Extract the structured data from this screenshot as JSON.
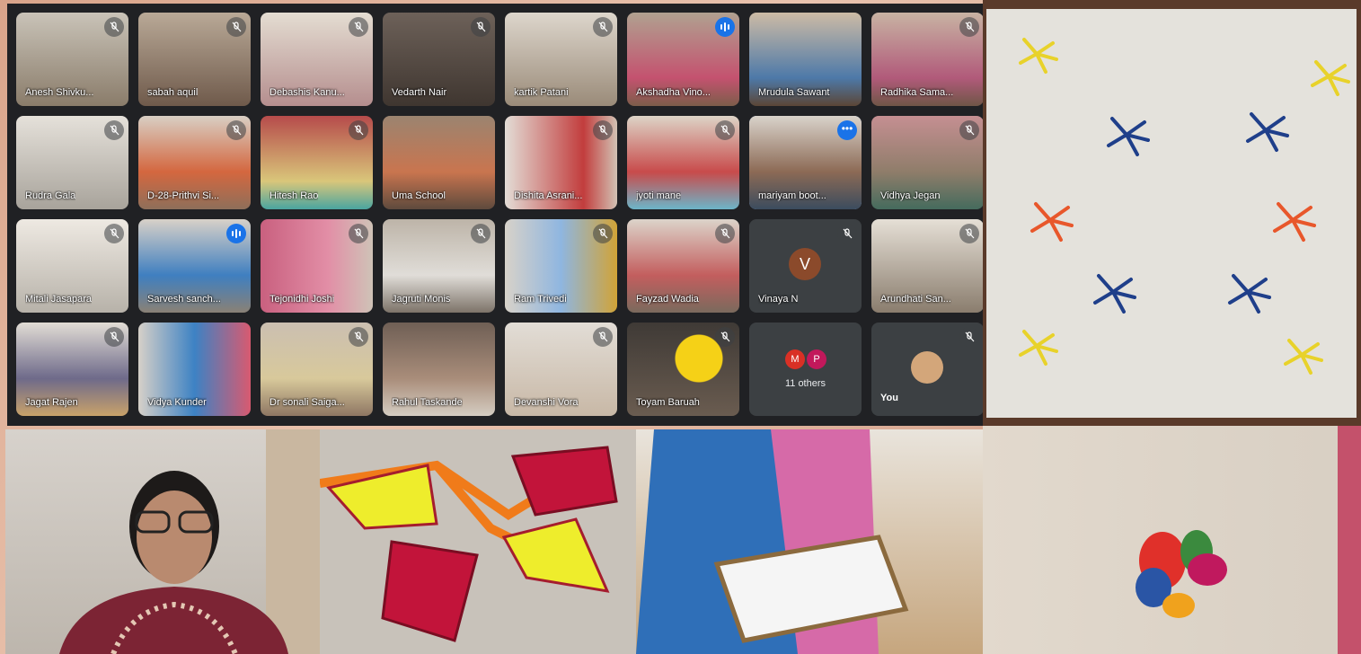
{
  "meet": {
    "tiles": [
      {
        "name": "Anesh Shivku..."
      },
      {
        "name": "sabah aquil"
      },
      {
        "name": "Debashis Kanu..."
      },
      {
        "name": "Vedarth Nair"
      },
      {
        "name": "kartik Patani"
      },
      {
        "name": "Akshadha Vino..."
      },
      {
        "name": "Mrudula Sawant"
      },
      {
        "name": "Radhika Sama..."
      },
      {
        "name": "Rudra Gala"
      },
      {
        "name": "D-28-Prithvi Si..."
      },
      {
        "name": "Hitesh Rao"
      },
      {
        "name": "Uma School"
      },
      {
        "name": "Dishita Asrani..."
      },
      {
        "name": "jyoti mane"
      },
      {
        "name": "mariyam boot..."
      },
      {
        "name": "Vidhya Jegan"
      },
      {
        "name": "Mitali Jasapara"
      },
      {
        "name": "Sarvesh sanch..."
      },
      {
        "name": "Tejonidhi Joshi"
      },
      {
        "name": "Jagruti Monis"
      },
      {
        "name": "Ram Trivedi"
      },
      {
        "name": "Fayzad Wadia"
      },
      {
        "name": "Vinaya N"
      },
      {
        "name": "Arundhati San..."
      },
      {
        "name": "Jagat Rajen"
      },
      {
        "name": "Vidya Kunder"
      },
      {
        "name": "Dr sonali Saiga..."
      },
      {
        "name": "Rahul Taskande"
      },
      {
        "name": "Devanshi Vora"
      },
      {
        "name": "Toyam Baruah"
      }
    ],
    "avatar_letter": "V",
    "others_initials": [
      "M",
      "P"
    ],
    "others_label": "11 others",
    "you_label": "You",
    "more_glyph": "•••"
  },
  "colors": {
    "meet_bg": "#202124",
    "tile_dark": "#3c4043",
    "speaking": "#1a73e8"
  }
}
